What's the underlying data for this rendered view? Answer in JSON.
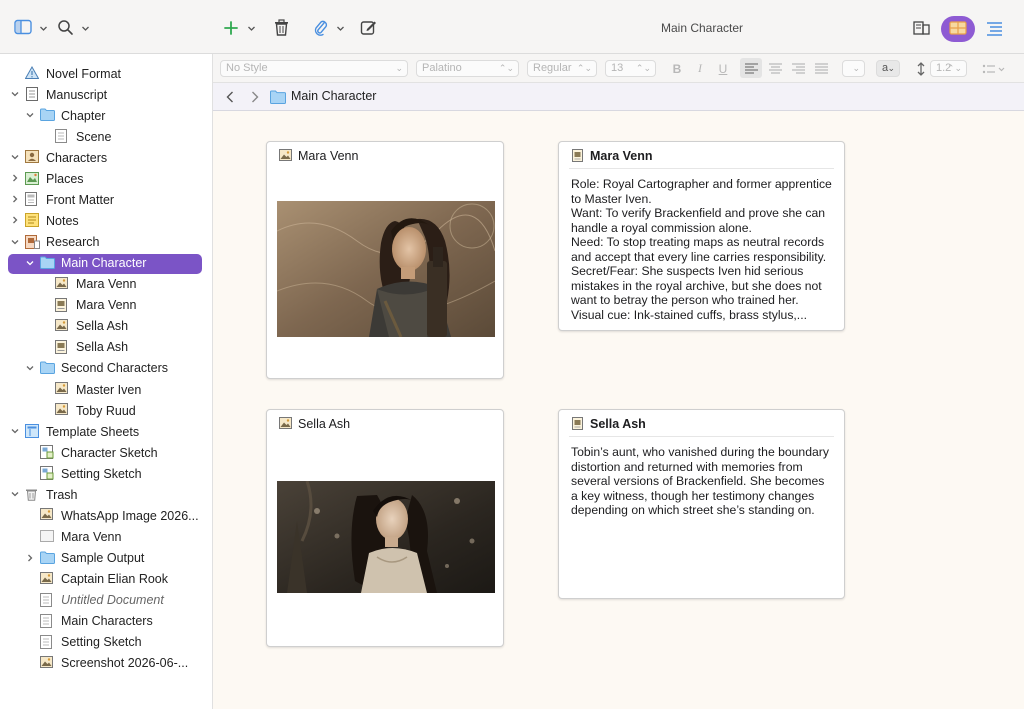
{
  "window": {
    "title": "Main Character"
  },
  "toolbar": {
    "icons": [
      "sidebar-icon",
      "search-icon",
      "add-icon",
      "trash-icon",
      "attachment-icon",
      "compose-icon",
      "inspector-compose-icon",
      "corkboard-icon",
      "outline-icon"
    ]
  },
  "formatbar": {
    "style": "No Style",
    "font": "Palatino",
    "weight": "Regular",
    "size": "13",
    "bold": "B",
    "italic": "I",
    "underline": "U",
    "text_color": "a",
    "line_spacing": "1.2"
  },
  "header": {
    "title": "Main Character"
  },
  "binder": [
    {
      "label": "Novel Format",
      "icon": "warning-doc-icon",
      "depth": 0,
      "disclosure": "none"
    },
    {
      "label": "Manuscript",
      "icon": "manuscript-icon",
      "depth": 0,
      "disclosure": "open"
    },
    {
      "label": "Chapter",
      "icon": "folder-icon",
      "depth": 1,
      "disclosure": "open"
    },
    {
      "label": "Scene",
      "icon": "document-icon",
      "depth": 2,
      "disclosure": "none"
    },
    {
      "label": "Characters",
      "icon": "character-icon",
      "depth": 0,
      "disclosure": "open"
    },
    {
      "label": "Places",
      "icon": "places-icon",
      "depth": 0,
      "disclosure": "closed"
    },
    {
      "label": "Front Matter",
      "icon": "front-matter-icon",
      "depth": 0,
      "disclosure": "closed"
    },
    {
      "label": "Notes",
      "icon": "notes-icon",
      "depth": 0,
      "disclosure": "closed"
    },
    {
      "label": "Research",
      "icon": "research-icon",
      "depth": 0,
      "disclosure": "open"
    },
    {
      "label": "Main Character",
      "icon": "folder-icon",
      "depth": 1,
      "disclosure": "open",
      "selected": true
    },
    {
      "label": "Mara Venn",
      "icon": "image-icon",
      "depth": 2,
      "disclosure": "none"
    },
    {
      "label": "Mara Venn",
      "icon": "image-doc-icon",
      "depth": 2,
      "disclosure": "none"
    },
    {
      "label": "Sella Ash",
      "icon": "image-icon",
      "depth": 2,
      "disclosure": "none"
    },
    {
      "label": "Sella Ash",
      "icon": "image-doc-icon",
      "depth": 2,
      "disclosure": "none"
    },
    {
      "label": "Second Characters",
      "icon": "folder-icon",
      "depth": 1,
      "disclosure": "open"
    },
    {
      "label": "Master Iven",
      "icon": "image-icon",
      "depth": 2,
      "disclosure": "none"
    },
    {
      "label": "Toby Ruud",
      "icon": "image-icon",
      "depth": 2,
      "disclosure": "none"
    },
    {
      "label": "Template Sheets",
      "icon": "template-icon",
      "depth": 0,
      "disclosure": "open"
    },
    {
      "label": "Character Sketch",
      "icon": "sketch-icon",
      "depth": 1,
      "disclosure": "none"
    },
    {
      "label": "Setting Sketch",
      "icon": "sketch-icon",
      "depth": 1,
      "disclosure": "none"
    },
    {
      "label": "Trash",
      "icon": "trash-icon",
      "depth": 0,
      "disclosure": "open"
    },
    {
      "label": "WhatsApp Image 2026...",
      "icon": "image-icon",
      "depth": 1,
      "disclosure": "none"
    },
    {
      "label": "Mara Venn",
      "icon": "blank-icon",
      "depth": 1,
      "disclosure": "none"
    },
    {
      "label": "Sample Output",
      "icon": "folder-icon",
      "depth": 1,
      "disclosure": "closed"
    },
    {
      "label": "Captain Elian Rook",
      "icon": "image-icon",
      "depth": 1,
      "disclosure": "none"
    },
    {
      "label": "Untitled Document",
      "icon": "document-icon",
      "depth": 1,
      "disclosure": "none",
      "italic": true
    },
    {
      "label": "Main Characters",
      "icon": "document-icon",
      "depth": 1,
      "disclosure": "none"
    },
    {
      "label": "Setting Sketch",
      "icon": "document-icon",
      "depth": 1,
      "disclosure": "none"
    },
    {
      "label": "Screenshot 2026-06-...",
      "icon": "image-icon",
      "depth": 1,
      "disclosure": "none"
    }
  ],
  "cards": [
    {
      "title": "Mara Venn",
      "type": "image",
      "icon": "image-icon"
    },
    {
      "title": "Mara Venn",
      "type": "text",
      "icon": "image-doc-icon",
      "body": "Role: Royal Cartographer and former apprentice to Master Iven.\nWant: To verify Brackenfield and prove she can handle a royal commission alone.\nNeed: To stop treating maps as neutral records and accept that every line carries responsibility.\nSecret/Fear: She suspects Iven hid serious mistakes in the royal archive, but she does not want to betray the person who trained her.\nVisual cue: Ink-stained cuffs, brass stylus,..."
    },
    {
      "title": "Sella Ash",
      "type": "image",
      "icon": "image-icon"
    },
    {
      "title": "Sella Ash",
      "type": "text",
      "icon": "image-doc-icon",
      "body": "Tobin’s aunt, who vanished during the boundary distortion and returned with memories from several versions of Brackenfield. She becomes a key witness, though her testimony changes depending on which street she’s standing on."
    }
  ],
  "colors": {
    "accent": "#7b54c6",
    "cork_pill": "#8e5bd3",
    "canvas": "#fdf9f3",
    "add": "#2fa84f",
    "attach": "#4a8fe0"
  }
}
